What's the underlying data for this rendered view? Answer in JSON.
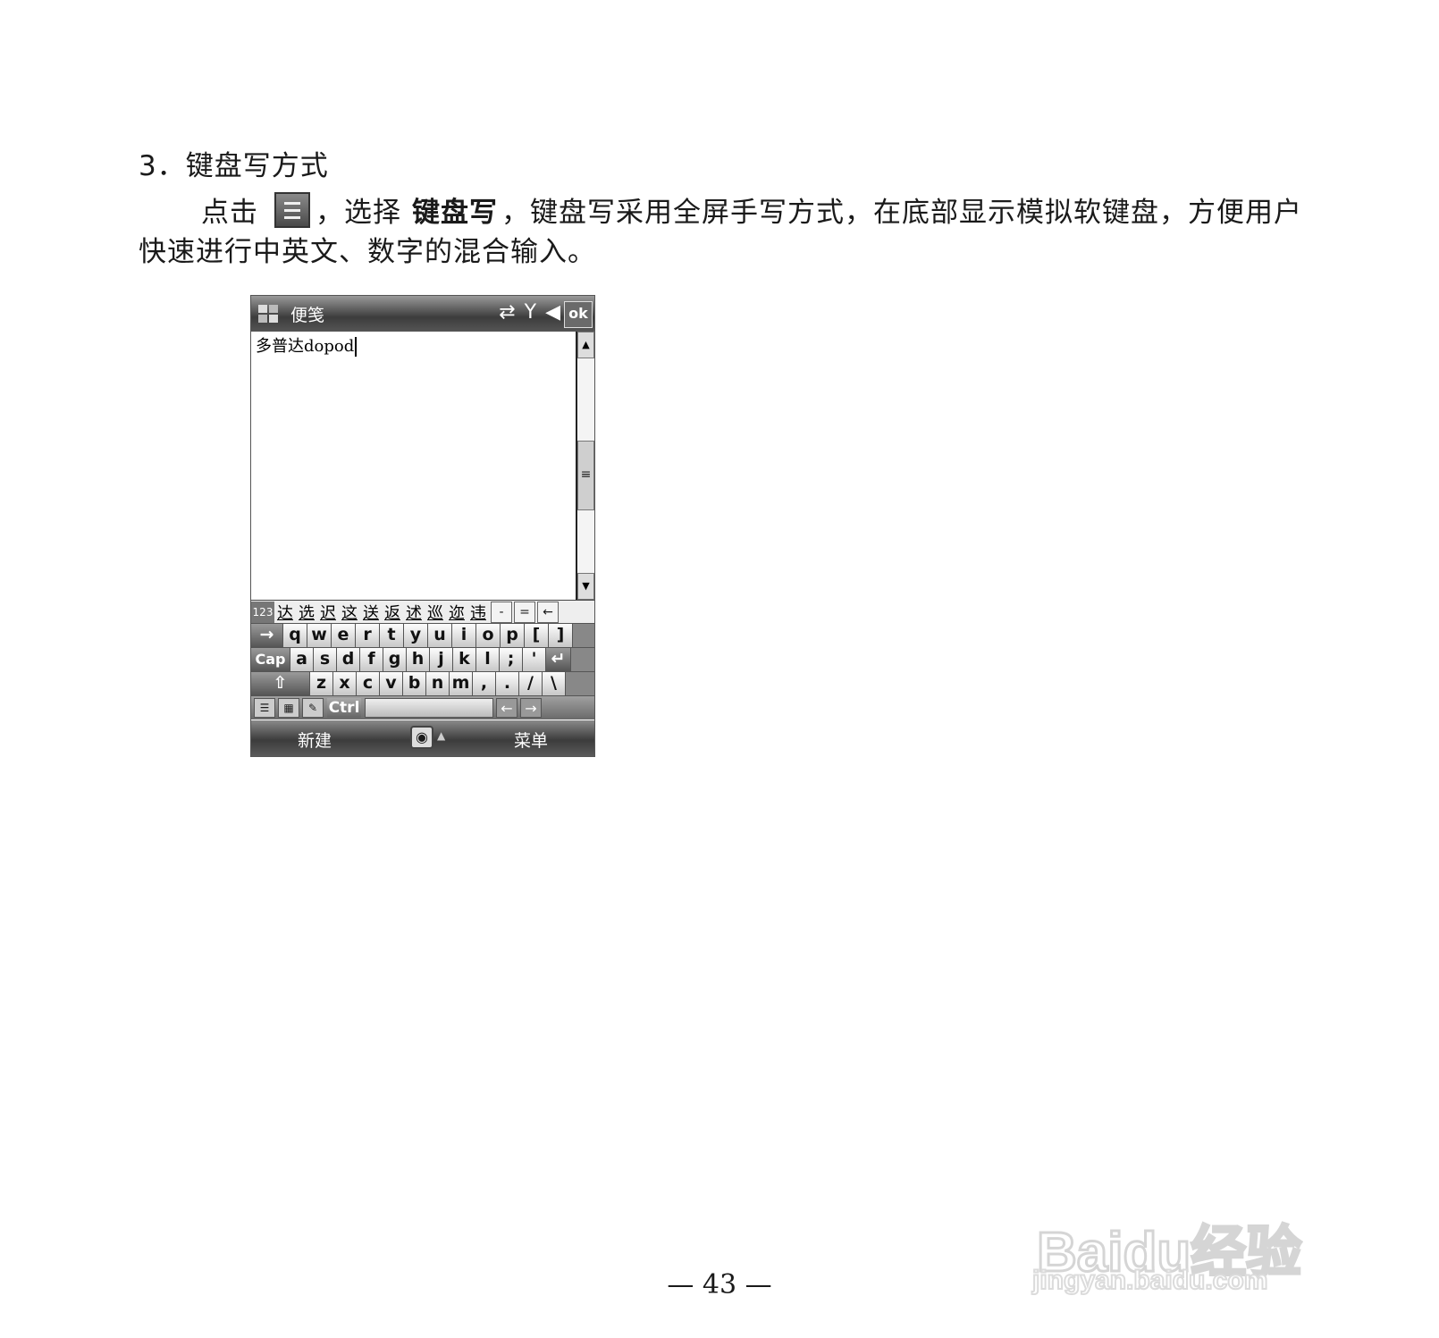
{
  "heading": "3．键盘写方式",
  "para": {
    "line1_before": "点击",
    "line1_mid": "，选择",
    "line1_bold": "键盘写",
    "line1_after": "，键盘写采用全屏手写方式，在底部显示模拟软键盘，方便用户",
    "line2": "快速进行中英文、数字的混合输入。",
    "icon": "input-menu-icon"
  },
  "device": {
    "title": "便笺",
    "ok_label": "ok",
    "status_icons": [
      "sync-icon",
      "signal-icon",
      "volume-icon"
    ],
    "editor_text": "多普达dopod",
    "candidates_num": "123",
    "candidates": [
      "达",
      "选",
      "迟",
      "这",
      "送",
      "返",
      "述",
      "巡",
      "迩",
      "违"
    ],
    "cand_controls": [
      "-",
      "=",
      "←"
    ],
    "rows": [
      [
        "→",
        "q",
        "w",
        "e",
        "r",
        "t",
        "y",
        "u",
        "i",
        "o",
        "p",
        "[",
        "]"
      ],
      [
        "Cap",
        "a",
        "s",
        "d",
        "f",
        "g",
        "h",
        "j",
        "k",
        "l",
        ";",
        "'",
        "↵"
      ],
      [
        "⇧",
        "z",
        "x",
        "c",
        "v",
        "b",
        "n",
        "m",
        ",",
        ".",
        "/",
        "\\"
      ]
    ],
    "ctrl_label": "Ctrl",
    "arrow_left": "←",
    "arrow_right": "→",
    "soft_left": "新建",
    "soft_right": "菜单"
  },
  "page_number": "— 43 —",
  "watermark": {
    "brand": "Baidu经验",
    "url": "jingyan.baidu.com"
  }
}
